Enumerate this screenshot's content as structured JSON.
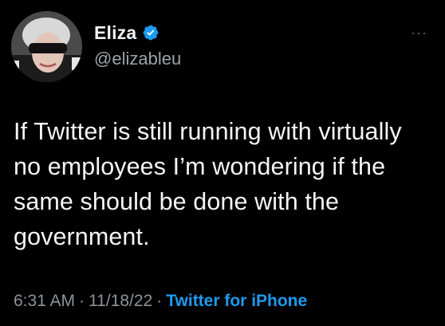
{
  "tweet": {
    "display_name": "Eliza",
    "handle": "@elizableu",
    "text": "If Twitter is still running with virtually no employees I’m wondering if the same should be done with the government.",
    "time": "6:31 AM",
    "date": "11/18/22",
    "source": "Twitter for iPhone",
    "separator": "·",
    "more_label": "···"
  },
  "icons": {
    "verified": "verified-badge-icon",
    "more": "more-dots-icon"
  },
  "colors": {
    "background": "#000000",
    "text": "#f4f5f6",
    "muted": "#8b949b",
    "accent": "#1d9bf0"
  }
}
